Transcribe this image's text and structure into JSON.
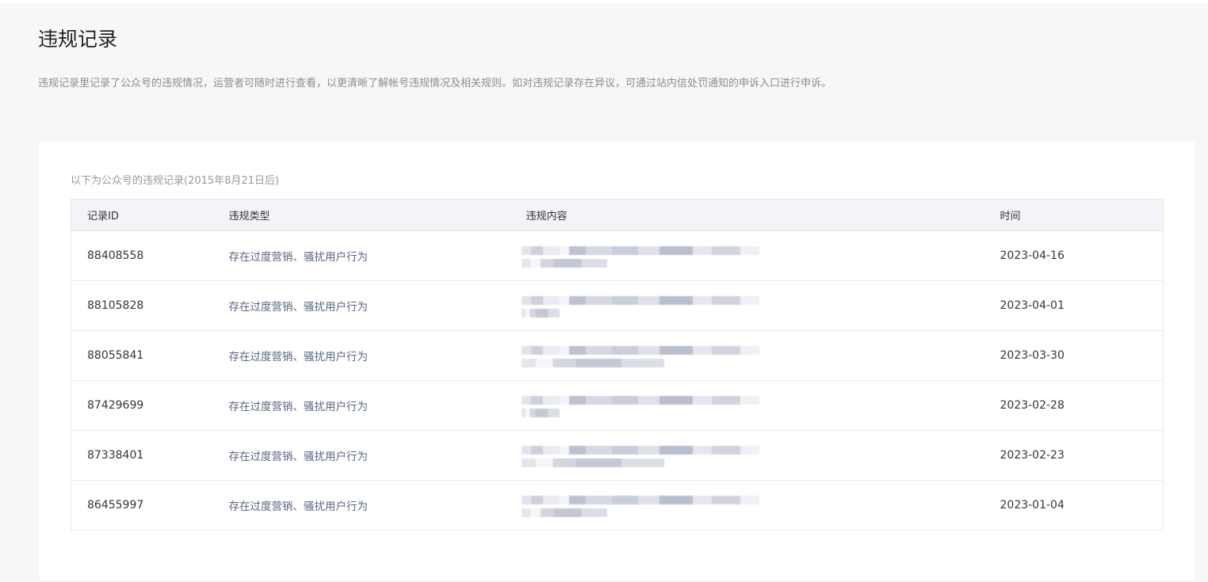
{
  "page": {
    "title": "违规记录",
    "description": "违规记录里记录了公众号的违规情况，运营者可随时进行查看，以更清晰了解帐号违规情况及相关规则。如对违规记录存在异议，可通过站内信处罚通知的申诉入口进行申诉。"
  },
  "card": {
    "subtitle": "以下为公众号的违规记录(2015年8月21日后)"
  },
  "table": {
    "headers": [
      "记录ID",
      "违规类型",
      "违规内容",
      "时间"
    ],
    "rows": [
      {
        "id": "88408558",
        "type": "存在过度营销、骚扰用户行为",
        "content": "[redacted]",
        "time": "2023-04-16"
      },
      {
        "id": "88105828",
        "type": "存在过度营销、骚扰用户行为",
        "content": "[redacted]",
        "time": "2023-04-01"
      },
      {
        "id": "88055841",
        "type": "存在过度营销、骚扰用户行为",
        "content": "[redacted]",
        "time": "2023-03-30"
      },
      {
        "id": "87429699",
        "type": "存在过度营销、骚扰用户行为",
        "content": "[redacted]",
        "time": "2023-02-28"
      },
      {
        "id": "87338401",
        "type": "存在过度营销、骚扰用户行为",
        "content": "[redacted]",
        "time": "2023-02-23"
      },
      {
        "id": "86455997",
        "type": "存在过度营销、骚扰用户行为",
        "content": "[redacted]",
        "time": "2023-01-04"
      }
    ]
  },
  "colors": {
    "background": "#f6f7f9",
    "card": "#ffffff",
    "header_row": "#f3f4f7",
    "type_text": "#5b6781",
    "border": "#e6e8ec"
  }
}
